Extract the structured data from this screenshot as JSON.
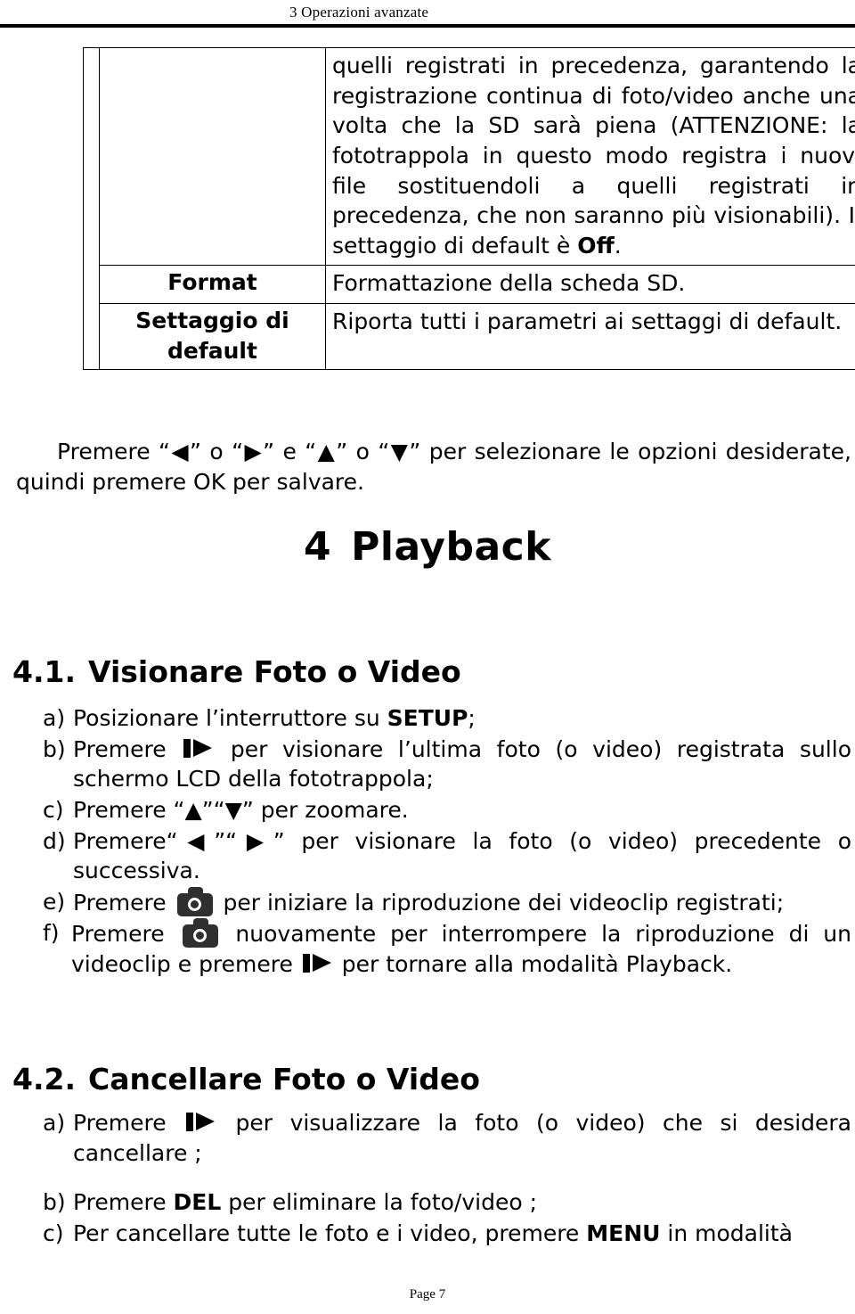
{
  "header": {
    "running_head": "3 Operazioni avanzate"
  },
  "settings_table": {
    "rows": [
      {
        "label": "",
        "description_html": "quelli registrati in precedenza, garantendo la registrazione continua di foto/video anche una volta che la SD sarà piena (ATTENZIONE: la fototrappola in questo modo registra i nuovi file sostituendoli a quelli registrati in precedenza, che non saranno più visionabili). Il settaggio di default è <b>Off</b>."
      },
      {
        "label": "Format",
        "description_html": "Formattazione della scheda SD."
      },
      {
        "label": "Settaggio di default",
        "description_html": "Riporta tutti i parametri ai settaggi di default."
      }
    ]
  },
  "press_note": {
    "text_html": "Premere “<span class=\"arrow\">◀</span>” o “<span class=\"arrow\">▶</span>” e “<span class=\"arrow\">▲</span>” o “<span class=\"arrow\">▼</span>” per selezionare le opzioni desiderate, quindi premere OK per salvare."
  },
  "chapter": {
    "number": "4",
    "title": "Playback"
  },
  "sections": [
    {
      "number": "4.1.",
      "title": "Visionare Foto o Video",
      "steps": [
        {
          "marker": "a)",
          "body_html": "Posizionare l’interruttore su <b>SETUP</b>;"
        },
        {
          "marker": "b)",
          "body_html": "Premere <span class=\"icon-playpause\" data-name=\"play-pause-icon\" data-interactable=\"false\"><span class=\"bar\"></span><span class=\"tri\"></span></span> per visionare l’ultima foto (o video) registrata sullo schermo LCD della fototrappola;"
        },
        {
          "marker": "c)",
          "body_html": "Premere “<span class=\"arrow\">▲</span>”“<span class=\"arrow\">▼</span>” per zoomare."
        },
        {
          "marker": "d)",
          "body_html": "Premere“<span class=\"arrow\">◀</span>”“<span class=\"arrow\">▶</span>” per visionare la foto (o video) precedente o successiva."
        },
        {
          "marker": "e)",
          "body_html": "Premere <span class=\"icon-camera\" data-name=\"camera-icon\" data-interactable=\"false\"><span class=\"bump\"></span><span class=\"body\"></span><span class=\"lens\"></span></span> per iniziare la riproduzione dei videoclip registrati;"
        },
        {
          "marker": "f)",
          "body_html": "Premere <span class=\"icon-camera\" data-name=\"camera-icon\" data-interactable=\"false\"><span class=\"bump\"></span><span class=\"body\"></span><span class=\"lens\"></span></span> nuovamente per interrompere la riproduzione di un videoclip e premere <span class=\"icon-playpause\" data-name=\"play-pause-icon\" data-interactable=\"false\"><span class=\"bar\"></span><span class=\"tri\"></span></span> per tornare alla modalità Playback."
        }
      ]
    },
    {
      "number": "4.2.",
      "title": "Cancellare Foto o Video",
      "steps": [
        {
          "marker": "a)",
          "body_html": "Premere <span class=\"icon-playpause\" data-name=\"play-pause-icon\" data-interactable=\"false\"><span class=\"bar\"></span><span class=\"tri\"></span></span> per visualizzare la foto (o video) che si desidera cancellare ;"
        },
        {
          "marker": "b)",
          "body_html": "Premere <b>DEL</b> per eliminare la foto/video ;"
        },
        {
          "marker": "c)",
          "body_html": "Per cancellare tutte le foto e i video, premere <b>MENU</b> in modalità"
        }
      ]
    }
  ],
  "footer": {
    "page_label": "Page 7"
  }
}
